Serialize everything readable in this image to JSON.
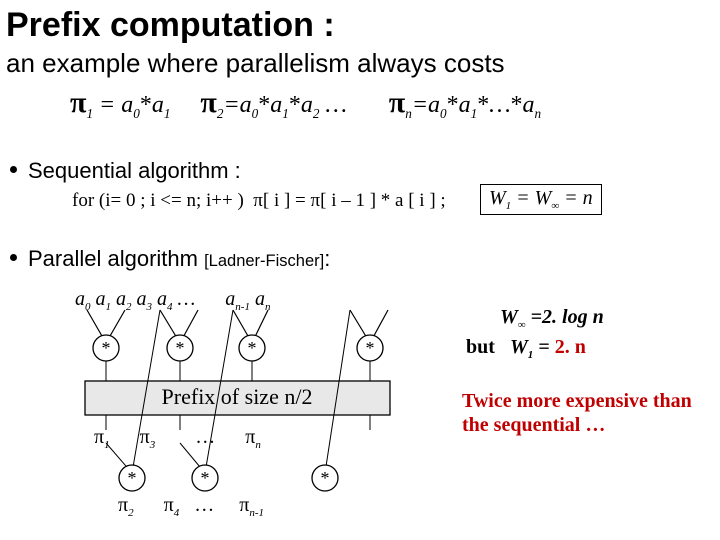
{
  "title": "Prefix computation :",
  "subtitle": "an example where parallelism always costs",
  "defs": {
    "d1_lhs": "π₁ = a₀*a₁",
    "d2_lhs": "π₂=a₀*a₁*a₂ …",
    "dn_lhs": "πₙ=a₀*a₁*…*aₙ"
  },
  "seq": {
    "heading": "Sequential algorithm :",
    "code": "for (i= 0 ; i <= n; i++ )  π[ i ] = π[ i – 1 ] * a [ i ] ;",
    "box": "W₁ = W∞ = n"
  },
  "par": {
    "heading": "Parallel algorithm ",
    "ref": "[Ladner-Fischer]",
    "colon": ":",
    "top_row": [
      "a₀",
      "a₁",
      "a₂",
      "a₃",
      "a₄",
      "…",
      "aₙ₋₁",
      "aₙ"
    ],
    "mid_label": "Prefix of size n/2",
    "pis_top": [
      "π₁",
      "π₃",
      "…",
      "πₙ"
    ],
    "pis_bot": [
      "π₂",
      "π₄",
      "…",
      "πₙ₋₁"
    ],
    "star": "*",
    "winf": "W∞ =2. log n",
    "but": "but",
    "w1": "W₁ = 2. n",
    "comment1": "Twice more expensive than",
    "comment2": "the sequential …"
  }
}
